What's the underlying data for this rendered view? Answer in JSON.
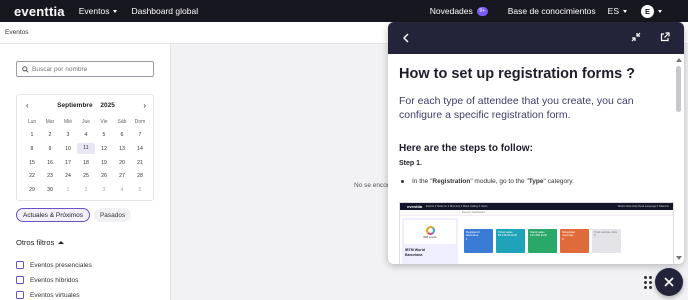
{
  "topbar": {
    "logo": "eventtia",
    "events_label": "Eventos",
    "dashboard_label": "Dashboard global",
    "novedades_label": "Novedades",
    "novedades_badge": "9+",
    "base_label": "Base de conocimientos",
    "lang_label": "ES",
    "avatar_initial": "E"
  },
  "breadcrumb": {
    "label": "Eventos"
  },
  "search": {
    "placeholder": "Buscar por nombre"
  },
  "calendar": {
    "prev": "‹",
    "next": "›",
    "month": "Septiembre",
    "year": "2025",
    "weekdays": [
      "Lun",
      "Mar",
      "Mié",
      "Jue",
      "Vie",
      "Sáb",
      "Dom"
    ],
    "weeks": [
      [
        "1",
        "2",
        "3",
        "4",
        "5",
        "6",
        "7"
      ],
      [
        "8",
        "9",
        "10",
        "11",
        "12",
        "13",
        "14"
      ],
      [
        "15",
        "16",
        "17",
        "18",
        "19",
        "20",
        "21"
      ],
      [
        "22",
        "23",
        "24",
        "25",
        "26",
        "27",
        "28"
      ],
      [
        "29",
        "30",
        "1",
        "2",
        "3",
        "4",
        "5"
      ]
    ]
  },
  "tabs": {
    "active": "Actuales & Próximos",
    "past": "Pasados"
  },
  "filters": {
    "title": "Otros filtros",
    "options": [
      "Eventos presenciales",
      "Eventos híbridos",
      "Eventos virtuales"
    ]
  },
  "main": {
    "empty_message": "No se encon"
  },
  "help": {
    "title": "How to set up registration forms ?",
    "intro": "For each type of attendee that you create, you can configure a specific registration form.",
    "steps_heading": "Here are the steps to follow:",
    "step1_label": "Step 1.",
    "bullet_prefix": "In the \"",
    "bullet_module": "Registration",
    "bullet_middle": "\" module, go to the \"",
    "bullet_type": "Type",
    "bullet_suffix": "\" category.",
    "preview": {
      "logo": "eventtia",
      "menu": "Events ▾   Tasks 9+ ▾   Directory ▾   Mass mailing ▾   Users",
      "right": "What's New   Help Desk   Language ▾   Mauricio",
      "sub": "Events   /   Dashboard",
      "card_label": "IBM events",
      "card_name": "IBTM World\nBarcelona",
      "tiles": [
        {
          "label": "Registered attendees",
          "value": "1",
          "color": "#3a7bd5"
        },
        {
          "label": "Ticket sales",
          "value": "83.136,64 EUR",
          "color": "#1fa3b8"
        },
        {
          "label": "Stand sales",
          "value": "141.650 EUR",
          "color": "#2aa86a"
        },
        {
          "label": "Scheduled meetings",
          "value": "0",
          "color": "#e06a3a"
        },
        {
          "label": "Total website visits",
          "value": "0",
          "color": "grey"
        }
      ]
    }
  }
}
